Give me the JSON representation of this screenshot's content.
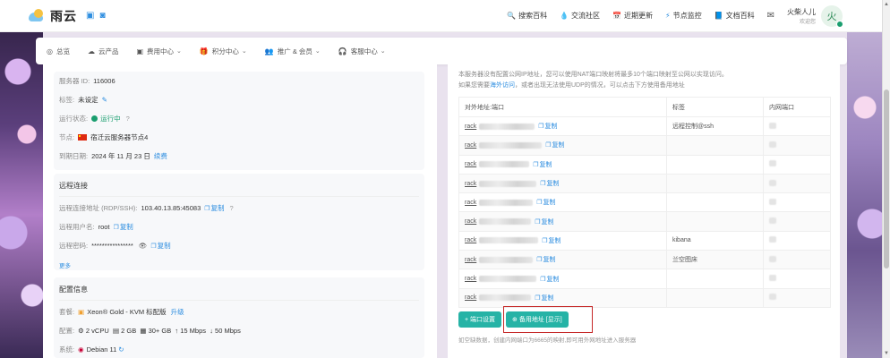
{
  "topbar": {
    "logo_text": "雨云",
    "nav": [
      {
        "icon": "search-icon",
        "glyph": "🔍",
        "label": "搜索百科"
      },
      {
        "icon": "community-icon",
        "glyph": "💧",
        "label": "交流社区"
      },
      {
        "icon": "update-icon",
        "glyph": "📅",
        "label": "近期更新"
      },
      {
        "icon": "monitor-icon",
        "glyph": "⚡",
        "label": "节点监控"
      },
      {
        "icon": "docs-icon",
        "glyph": "📘",
        "label": "文档百科"
      }
    ],
    "user_name": "火柴人儿",
    "user_sub": "欢迎您",
    "avatar_char": "火"
  },
  "menubar": [
    {
      "icon": "overview-icon",
      "glyph": "◎",
      "label": "总览",
      "chev": ""
    },
    {
      "icon": "cloud-icon",
      "glyph": "☁",
      "label": "云产品",
      "chev": ""
    },
    {
      "icon": "billing-icon",
      "glyph": "▣",
      "label": "费用中心",
      "chev": "⌄"
    },
    {
      "icon": "points-icon",
      "glyph": "🎁",
      "label": "积分中心",
      "chev": "⌄"
    },
    {
      "icon": "promo-icon",
      "glyph": "👥",
      "label": "推广 & 会员",
      "chev": "⌄"
    },
    {
      "icon": "service-icon",
      "glyph": "🎧",
      "label": "客服中心",
      "chev": "⌄"
    }
  ],
  "server": {
    "id_label": "服务器 ID:",
    "id": "116006",
    "tag_label": "标签:",
    "tag": "未设定",
    "status_label": "运行状态:",
    "status": "运行中",
    "node_label": "节点:",
    "node": "宿迁云服务器节点4",
    "expire_label": "到期日期:",
    "expire": "2024 年 11 月 23 日",
    "renew": "续费"
  },
  "remote": {
    "title": "远程连接",
    "addr_label": "远程连接地址 (RDP/SSH):",
    "addr": "103.40.13.85:45083",
    "user_label": "远程用户名:",
    "user": "root",
    "pwd_label": "远程密码:",
    "pwd": "****************",
    "copy": "复制",
    "more": "更多"
  },
  "config": {
    "title": "配置信息",
    "pkg_label": "套餐:",
    "pkg": "Xeon® Gold - KVM 标配版",
    "upgrade": "升级",
    "spec_label": "配置:",
    "cpu": "2 vCPU",
    "ram": "2 GB",
    "disk": "30+ GB",
    "up": "15 Mbps",
    "down": "50 Mbps",
    "os_label": "系统:",
    "os": "Debian 11"
  },
  "nat": {
    "notice1": "本服务器没有配置公网IP地址，您可以使用NAT端口映射将最多10个端口映射至公网以实现访问。",
    "notice2a": "如果您需要",
    "notice2link": "海外访问",
    "notice2b": "，或者出现无法使用UDP的情况，可以点击下方使用备用地址",
    "headers": [
      "对外地址:端口",
      "标签",
      "内网端口"
    ],
    "rows": [
      {
        "host": "rack",
        "tag": "远程控制@ssh"
      },
      {
        "host": "rack",
        "tag": ""
      },
      {
        "host": "rack",
        "tag": ""
      },
      {
        "host": "rack",
        "tag": ""
      },
      {
        "host": "rack",
        "tag": ""
      },
      {
        "host": "rack",
        "tag": ""
      },
      {
        "host": "rack",
        "tag": "kibana"
      },
      {
        "host": "rack",
        "tag": "兰空图床"
      },
      {
        "host": "rack",
        "tag": ""
      },
      {
        "host": "rack",
        "tag": ""
      }
    ],
    "copy": "复制",
    "btn_port": "+ 端口设置",
    "btn_backup": "⊕ 备用地址 [显示]",
    "hint": "如空缺数据，创建内网端口为6665的映射,即可用外网地址进入服务器"
  }
}
